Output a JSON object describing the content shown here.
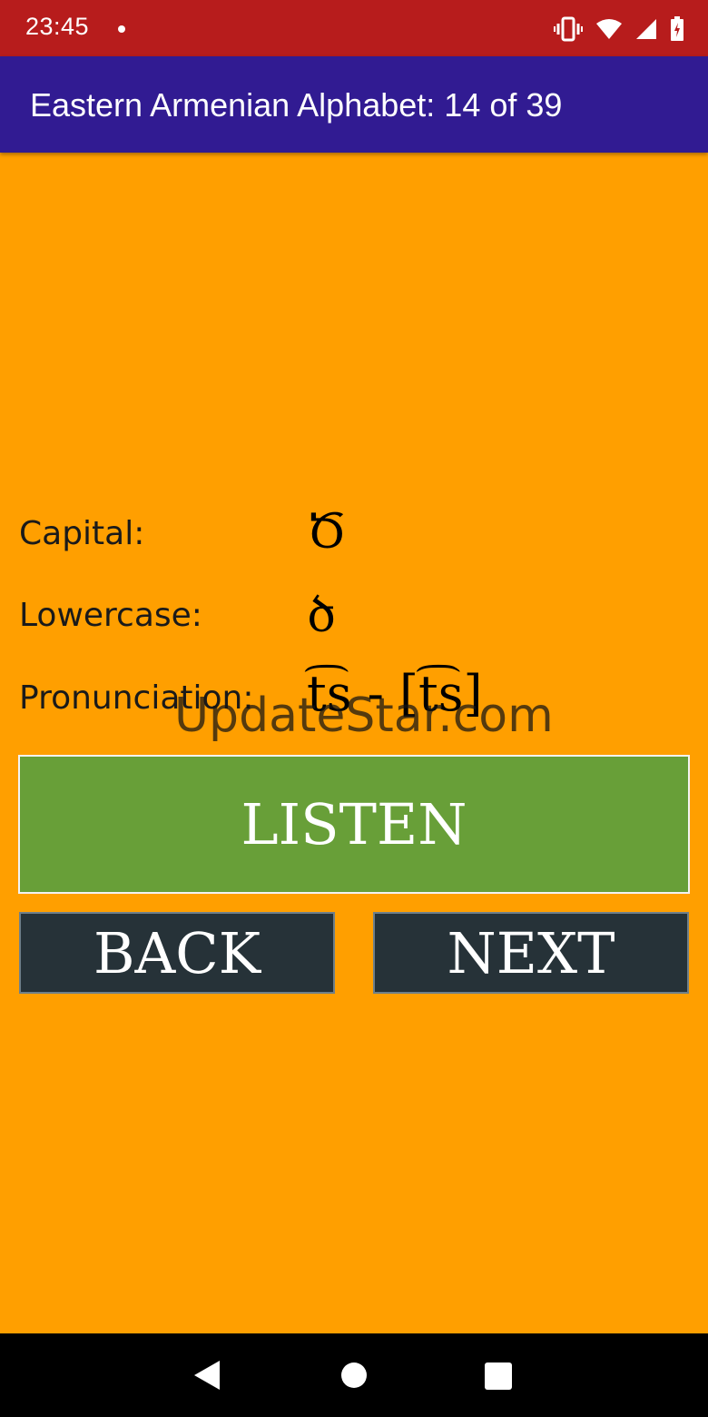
{
  "status_bar": {
    "time": "23:45",
    "icons": [
      "notification-dot-icon",
      "vibrate-icon",
      "wifi-icon",
      "signal-icon",
      "battery-icon"
    ]
  },
  "app_bar": {
    "title": "Eastern Armenian Alphabet: 14 of 39"
  },
  "letter": {
    "capital_label": "Capital:",
    "capital_value": "Ծ",
    "lowercase_label": "Lowercase:",
    "lowercase_value": "ծ",
    "pronunciation_label": "Pronunciation:",
    "pronunciation_value": "t͡s - [t͡s]"
  },
  "watermark": "UpdateStar.com",
  "buttons": {
    "listen": "LISTEN",
    "back": "BACK",
    "next": "NEXT"
  },
  "colors": {
    "background": "#FF9F00",
    "status_bar": "#B71C1C",
    "app_bar": "#311B92",
    "listen_button": "#689F38",
    "nav_buttons": "#263238"
  },
  "system_nav": [
    "back-triangle-icon",
    "home-circle-icon",
    "recents-square-icon"
  ]
}
